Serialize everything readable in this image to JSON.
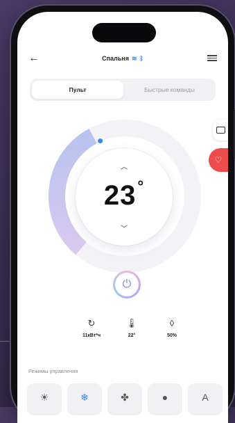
{
  "header": {
    "back_icon": "arrow-left-icon",
    "title": "Спальня",
    "wifi_icon": "wifi-icon",
    "bluetooth_icon": "bluetooth-icon",
    "settings_icon": "sliders-icon"
  },
  "tabs": [
    {
      "label": "Пульт",
      "active": true
    },
    {
      "label": "Быстрые команды",
      "active": false
    }
  ],
  "dial": {
    "temperature": "23",
    "unit": "°",
    "up_icon": "chevron-up-icon",
    "down_icon": "chevron-down-icon",
    "accent": "#b9c3ee"
  },
  "stats": [
    {
      "icon": "energy-icon",
      "value": "11кВт*ч"
    },
    {
      "icon": "thermometer-icon",
      "value": "22°"
    },
    {
      "icon": "humidity-icon",
      "value": "50%"
    }
  ],
  "modes_label": "Режимы управления",
  "modes": [
    {
      "icon": "sun-icon",
      "glyph": "☀"
    },
    {
      "icon": "snowflake-icon",
      "glyph": "❄"
    },
    {
      "icon": "fan-icon",
      "glyph": "✤"
    },
    {
      "icon": "drop-icon",
      "glyph": "●"
    },
    {
      "icon": "auto-icon",
      "glyph": "A"
    }
  ],
  "colors": {
    "accent_blue": "#2f8cf0",
    "alert_red": "#ef4b4b"
  }
}
